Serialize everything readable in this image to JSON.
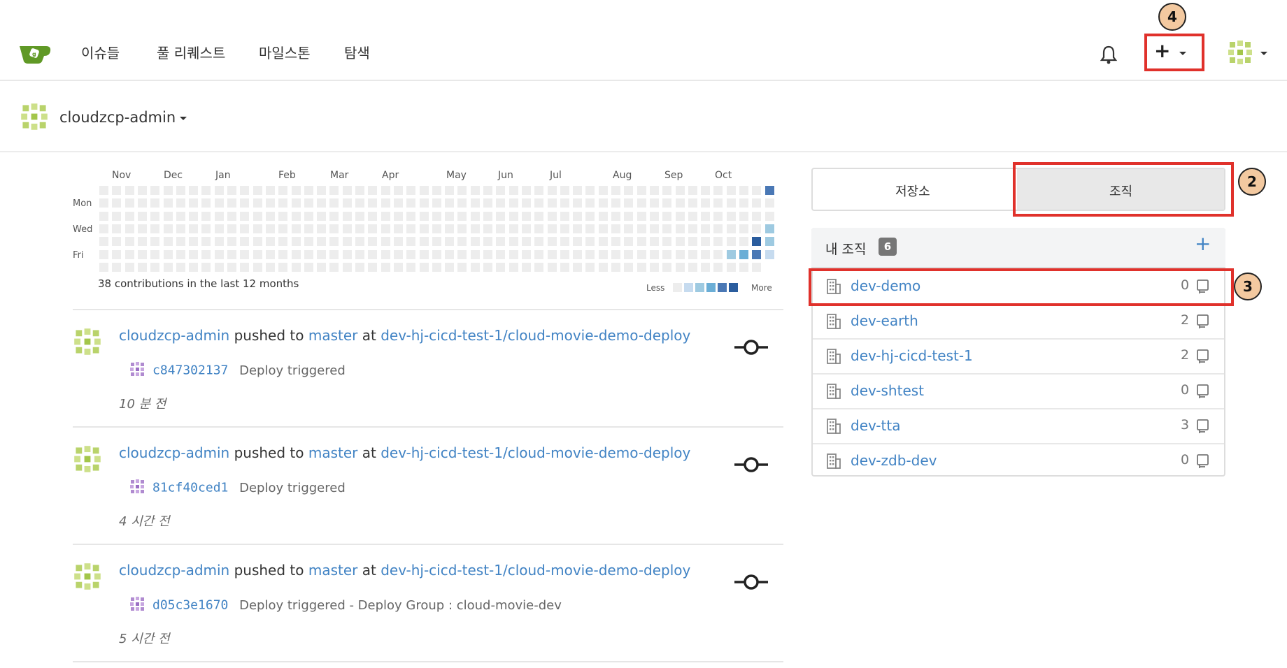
{
  "nav": {
    "items": [
      "이슈들",
      "풀 리퀘스트",
      "마일스톤",
      "탐색"
    ],
    "plus": "+"
  },
  "context": {
    "name": "cloudzcp-admin"
  },
  "heatmap": {
    "months": [
      "Nov",
      "Dec",
      "Jan",
      "Feb",
      "Mar",
      "Apr",
      "May",
      "Jun",
      "Jul",
      "Aug",
      "Sep",
      "Oct"
    ],
    "days": [
      "Mon",
      "Wed",
      "Fri"
    ],
    "summary": "38 contributions in the last 12 months",
    "legend_less": "Less",
    "legend_more": "More",
    "colors": [
      "#ededed",
      "#c6dbef",
      "#9ecae1",
      "#6baed6",
      "#4a78b5",
      "#2b5d9e"
    ]
  },
  "feed": [
    {
      "user": "cloudzcp-admin",
      "action": " pushed to ",
      "branch": "master",
      "at": " at ",
      "repo": "dev-hj-cicd-test-1/cloud-movie-demo-deploy",
      "sha": "c847302137",
      "message": "Deploy triggered",
      "time": "10 분 전"
    },
    {
      "user": "cloudzcp-admin",
      "action": " pushed to ",
      "branch": "master",
      "at": " at ",
      "repo": "dev-hj-cicd-test-1/cloud-movie-demo-deploy",
      "sha": "81cf40ced1",
      "message": "Deploy triggered",
      "time": "4 시간 전"
    },
    {
      "user": "cloudzcp-admin",
      "action": " pushed to ",
      "branch": "master",
      "at": " at ",
      "repo": "dev-hj-cicd-test-1/cloud-movie-demo-deploy",
      "sha": "d05c3e1670",
      "message": "Deploy triggered - Deploy Group : cloud-movie-dev",
      "time": "5 시간 전"
    }
  ],
  "tabs": {
    "repos": "저장소",
    "orgs": "조직"
  },
  "orgs": {
    "title": "내 조직",
    "count": "6",
    "add": "+",
    "items": [
      {
        "name": "dev-demo",
        "count": "0"
      },
      {
        "name": "dev-earth",
        "count": "2"
      },
      {
        "name": "dev-hj-cicd-test-1",
        "count": "2"
      },
      {
        "name": "dev-shtest",
        "count": "0"
      },
      {
        "name": "dev-tta",
        "count": "3"
      },
      {
        "name": "dev-zdb-dev",
        "count": "0"
      }
    ]
  },
  "annotations": [
    "4",
    "2",
    "3"
  ],
  "accent": "#4183c4",
  "highlight": "#e0312b"
}
